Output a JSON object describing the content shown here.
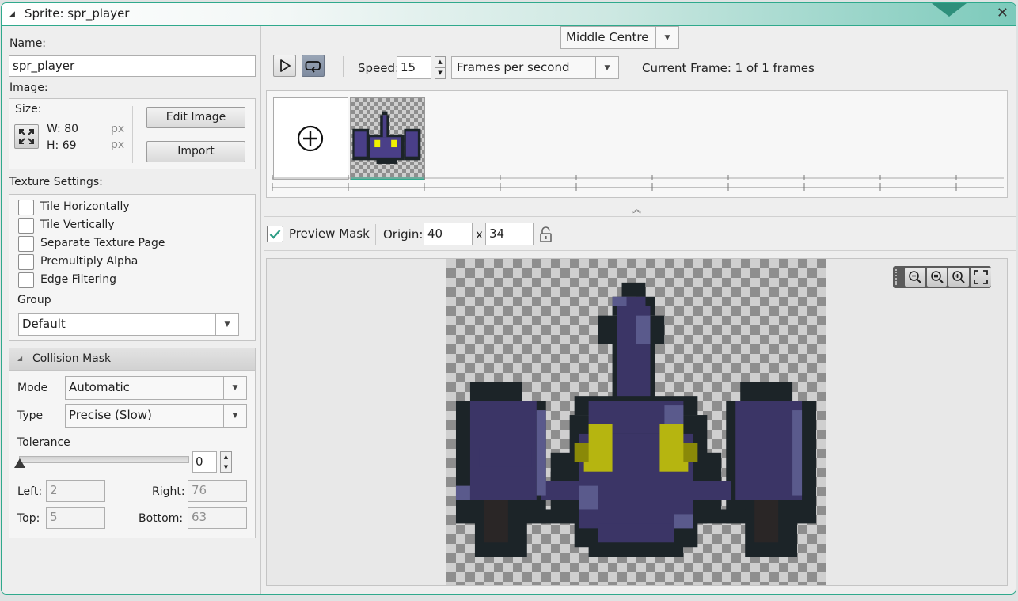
{
  "window": {
    "title": "Sprite: spr_player"
  },
  "left": {
    "name_label": "Name:",
    "name_value": "spr_player",
    "image_label": "Image:",
    "size_label": "Size:",
    "width": "W: 80",
    "height": "H: 69",
    "unit": "px",
    "edit_image_button": "Edit Image",
    "import_button": "Import",
    "texture_settings_label": "Texture Settings:",
    "texture_options": [
      {
        "label": "Tile Horizontally",
        "checked": false
      },
      {
        "label": "Tile Vertically",
        "checked": false
      },
      {
        "label": "Separate Texture Page",
        "checked": false
      },
      {
        "label": "Premultiply Alpha",
        "checked": false
      },
      {
        "label": "Edge Filtering",
        "checked": false
      }
    ],
    "group_label": "Group",
    "group_value": "Default",
    "collision": {
      "header": "Collision Mask",
      "mode_label": "Mode",
      "mode_value": "Automatic",
      "type_label": "Type",
      "type_value": "Precise (Slow)",
      "tolerance_label": "Tolerance",
      "tolerance_value": "0",
      "tolerance_level": 0,
      "left_label": "Left:",
      "left_value": "2",
      "right_label": "Right:",
      "right_value": "76",
      "top_label": "Top:",
      "top_value": "5",
      "bottom_label": "Bottom:",
      "bottom_value": "63"
    }
  },
  "toolbar": {
    "speed_label": "Speed:",
    "speed_value": "15",
    "speed_unit": "Frames per second",
    "current_frame": "Current Frame: 1 of 1 frames"
  },
  "preview": {
    "preview_mask_label": "Preview Mask",
    "preview_mask_checked": true,
    "origin_label": "Origin:",
    "origin_x": "40",
    "origin_sep": "x",
    "origin_y": "34",
    "origin_preset": "Middle Centre"
  },
  "colors": {
    "accent": "#2fa98c",
    "ship_outline": "#1c2428",
    "ship_body": "#3b3566",
    "ship_highlight": "#5a5a8c",
    "ship_eyes": "#b6b510"
  }
}
